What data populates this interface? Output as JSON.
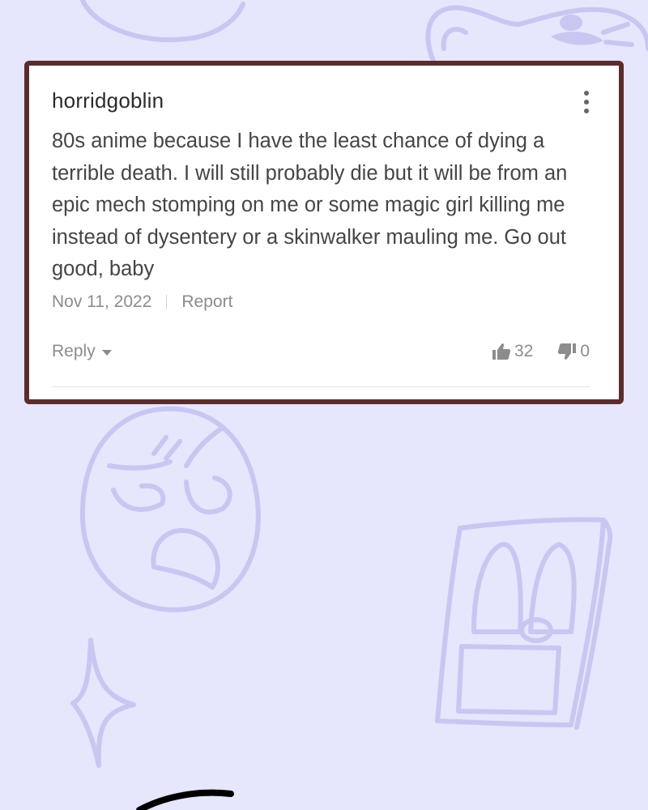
{
  "comment": {
    "username": "horridgoblin",
    "body": "80s anime because I have the least chance of dying a terrible death. I will still probably die but it will be from an epic mech stomping on me or some magic girl killing me instead of dysentery or a skinwalker mauling me. Go out good, baby",
    "date": "Nov 11, 2022",
    "report_label": "Report",
    "reply_label": "Reply",
    "upvotes": "32",
    "downvotes": "0"
  },
  "icons": {
    "menu": "more-vertical-icon",
    "reply_dropdown": "caret-down-icon",
    "upvote": "thumbs-up-icon",
    "downvote": "thumbs-down-icon"
  },
  "colors": {
    "background": "#e6e6fd",
    "doodle": "#c7c7f2",
    "card_border": "#5a2c2c",
    "text_primary": "#2b2b2b",
    "text_body": "#454545",
    "text_muted": "#8c8c8c"
  }
}
